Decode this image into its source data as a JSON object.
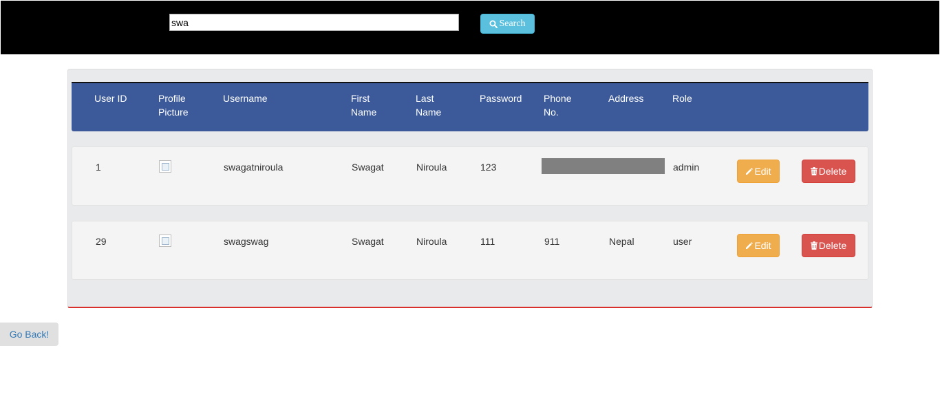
{
  "search": {
    "value": "swa",
    "button_label": "Search"
  },
  "table": {
    "headers": [
      "User ID",
      "Profile\nPicture",
      "Username",
      "First\nName",
      "Last\nName",
      "Password",
      "Phone\nNo.",
      "Address",
      "Role"
    ],
    "rows": [
      {
        "user_id": "1",
        "username": "swagatniroula",
        "first_name": "Swagat",
        "last_name": "Niroula",
        "password": "123",
        "phone": "",
        "address": "",
        "role": "admin",
        "edit_label": "Edit",
        "delete_label": "Delete"
      },
      {
        "user_id": "29",
        "username": "swagswag",
        "first_name": "Swagat",
        "last_name": "Niroula",
        "password": "111",
        "phone": "911",
        "address": "Nepal",
        "role": "user",
        "edit_label": "Edit",
        "delete_label": "Delete"
      }
    ]
  },
  "footer": {
    "go_back_label": "Go Back!"
  },
  "colors": {
    "header_bg": "#3c5a9a",
    "edit": "#f0ad4e",
    "delete": "#d9534f",
    "search": "#5bc0de",
    "panel_border": "#d9302c"
  },
  "icons": {
    "search": "search-icon",
    "edit": "pencil-icon",
    "delete": "trash-icon"
  }
}
